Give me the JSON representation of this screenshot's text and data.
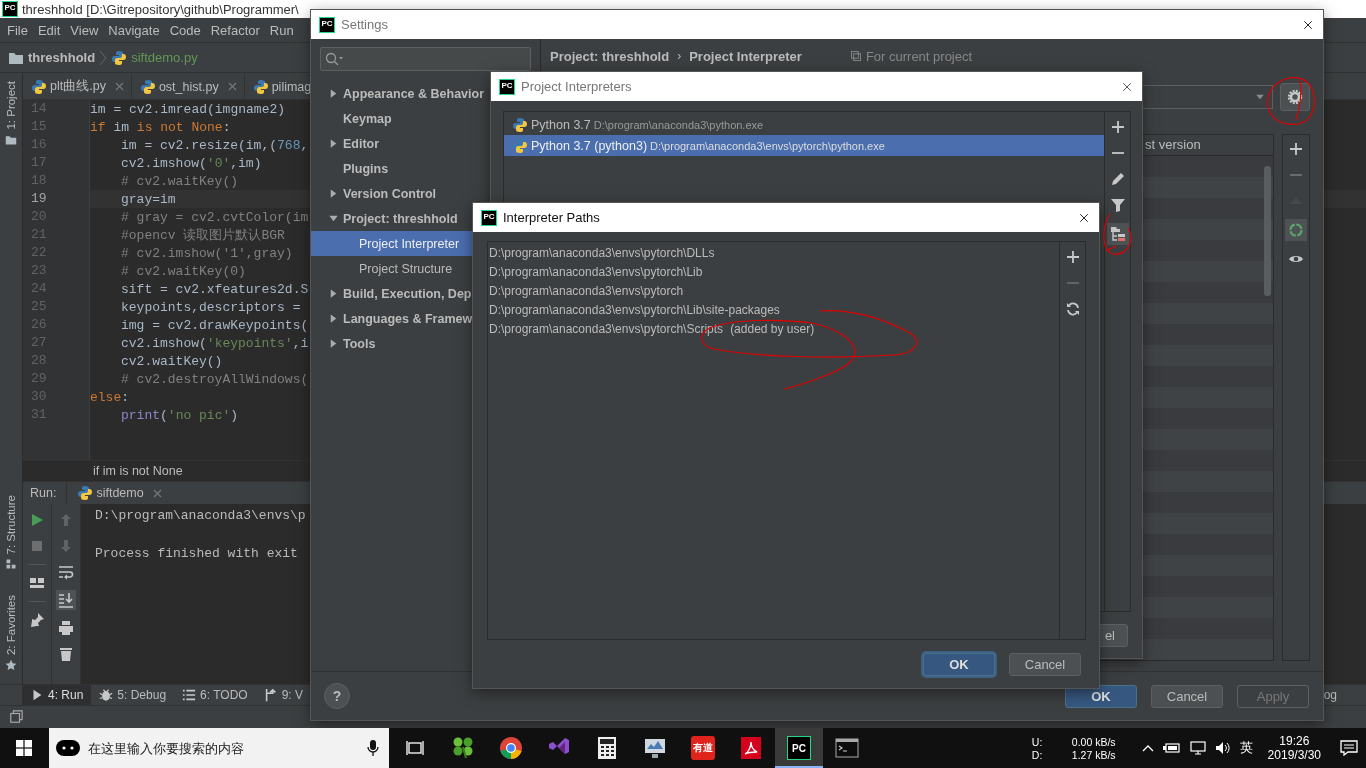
{
  "ide": {
    "logo": "PC",
    "title": "threshhold [D:\\Gitrepository\\github\\Programmer\\",
    "menu": [
      "File",
      "Edit",
      "View",
      "Navigate",
      "Code",
      "Refactor",
      "Run"
    ],
    "breadcrumb": {
      "project": "threshhold",
      "file": "siftdemo.py"
    },
    "side_tools": [
      {
        "label": "1: Project",
        "kind": "project"
      },
      {
        "label": "7: Structure",
        "kind": "structure"
      },
      {
        "label": "2: Favorites",
        "kind": "favorites"
      }
    ],
    "tabs": [
      {
        "label": "plt曲线.py",
        "closable": true
      },
      {
        "label": "ost_hist.py",
        "closable": true
      },
      {
        "label": "pilimag",
        "closable": false
      }
    ],
    "code_lines": [
      {
        "number": "14",
        "caret": false,
        "indented": false,
        "tokens": [
          {
            "kind": "plain",
            "text": "im = cv2.imread(imgname2)"
          }
        ]
      },
      {
        "number": "15",
        "caret": false,
        "indented": false,
        "tokens": [
          {
            "kind": "keyword",
            "text": "if"
          },
          {
            "kind": "plain",
            "text": " im "
          },
          {
            "kind": "keyword",
            "text": "is not None"
          },
          {
            "kind": "plain",
            "text": ":"
          }
        ]
      },
      {
        "number": "16",
        "caret": false,
        "indented": true,
        "tokens": [
          {
            "kind": "plain",
            "text": "im = cv2.resize(im,("
          },
          {
            "kind": "number",
            "text": "768"
          },
          {
            "kind": "plain",
            "text": ","
          }
        ]
      },
      {
        "number": "17",
        "caret": false,
        "indented": true,
        "tokens": [
          {
            "kind": "plain",
            "text": "cv2.imshow("
          },
          {
            "kind": "string",
            "text": "'0'"
          },
          {
            "kind": "plain",
            "text": ",im)"
          }
        ]
      },
      {
        "number": "18",
        "caret": false,
        "indented": true,
        "tokens": [
          {
            "kind": "comment",
            "text": "# cv2.waitKey()"
          }
        ]
      },
      {
        "number": "19",
        "caret": true,
        "indented": true,
        "tokens": [
          {
            "kind": "plain",
            "text": "gray=im"
          }
        ]
      },
      {
        "number": "20",
        "caret": false,
        "indented": true,
        "tokens": [
          {
            "kind": "comment",
            "text": "# gray = cv2.cvtColor(im"
          }
        ]
      },
      {
        "number": "21",
        "caret": false,
        "indented": true,
        "tokens": [
          {
            "kind": "comment",
            "text": "#opencv 读取图片默认BGR"
          }
        ]
      },
      {
        "number": "22",
        "caret": false,
        "indented": true,
        "tokens": [
          {
            "kind": "comment",
            "text": "# cv2.imshow('1',gray)"
          }
        ]
      },
      {
        "number": "23",
        "caret": false,
        "indented": true,
        "tokens": [
          {
            "kind": "comment",
            "text": "# cv2.waitKey(0)"
          }
        ]
      },
      {
        "number": "24",
        "caret": false,
        "indented": true,
        "tokens": [
          {
            "kind": "plain",
            "text": "sift = cv2.xfeatures2d.S"
          }
        ]
      },
      {
        "number": "25",
        "caret": false,
        "indented": true,
        "tokens": [
          {
            "kind": "plain",
            "text": "keypoints,descriptors ="
          }
        ]
      },
      {
        "number": "26",
        "caret": false,
        "indented": true,
        "tokens": [
          {
            "kind": "plain",
            "text": "img = cv2.drawKeypoints("
          }
        ]
      },
      {
        "number": "27",
        "caret": false,
        "indented": true,
        "tokens": [
          {
            "kind": "plain",
            "text": "cv2.imshow("
          },
          {
            "kind": "string",
            "text": "'keypoints'"
          },
          {
            "kind": "plain",
            "text": ",i"
          }
        ]
      },
      {
        "number": "28",
        "caret": false,
        "indented": true,
        "tokens": [
          {
            "kind": "plain",
            "text": "cv2.waitKey()"
          }
        ]
      },
      {
        "number": "29",
        "caret": false,
        "indented": true,
        "tokens": [
          {
            "kind": "comment",
            "text": "# cv2.destroyAllWindows("
          }
        ]
      },
      {
        "number": "30",
        "caret": false,
        "indented": false,
        "tokens": [
          {
            "kind": "keyword",
            "text": "else"
          },
          {
            "kind": "plain",
            "text": ":"
          }
        ]
      },
      {
        "number": "31",
        "caret": false,
        "indented": true,
        "tokens": [
          {
            "kind": "builtin",
            "text": "print"
          },
          {
            "kind": "plain",
            "text": "("
          },
          {
            "kind": "string",
            "text": "'no pic'"
          },
          {
            "kind": "plain",
            "text": ")"
          }
        ]
      }
    ],
    "code_crumb": "if im is not None",
    "run": {
      "label": "Run:",
      "tab": "siftdemo",
      "console": [
        "D:\\program\\anaconda3\\envs\\p",
        "Process finished with exit"
      ]
    },
    "tool_buttons": [
      {
        "label": "4: Run",
        "kind": "run",
        "selected": true
      },
      {
        "label": "5: Debug",
        "kind": "debug",
        "selected": false
      },
      {
        "label": "6: TODO",
        "kind": "todo",
        "selected": false
      },
      {
        "label": "9: V",
        "kind": "vcs",
        "selected": false
      }
    ],
    "event_log": "og"
  },
  "settings": {
    "logo": "PC",
    "title": "Settings",
    "tree": [
      {
        "label": "Appearance & Behavior",
        "expanded": false,
        "selected": false
      },
      {
        "label": "Keymap",
        "selected": false
      },
      {
        "label": "Editor",
        "expanded": false,
        "selected": false
      },
      {
        "label": "Plugins",
        "selected": false
      },
      {
        "label": "Version Control",
        "expanded": false,
        "selected": false
      },
      {
        "label": "Project: threshhold",
        "expanded": true,
        "selected": false,
        "children": [
          {
            "label": "Project Interpreter",
            "selected": true
          },
          {
            "label": "Project Structure",
            "selected": false
          }
        ]
      },
      {
        "label": "Build, Execution, Dep",
        "expanded": false,
        "selected": false
      },
      {
        "label": "Languages & Framew",
        "expanded": false,
        "selected": false
      },
      {
        "label": "Tools",
        "expanded": false,
        "selected": false
      }
    ],
    "header": {
      "project": "Project: threshhold",
      "separator": "›",
      "page": "Project Interpreter",
      "scope": "For current project"
    },
    "packages": {
      "column": "st version"
    },
    "package_tools": [
      {
        "kind": "add",
        "disabled": false
      },
      {
        "kind": "remove",
        "disabled": true
      },
      {
        "kind": "up",
        "disabled": true
      },
      {
        "kind": "refresh",
        "disabled": false
      },
      {
        "kind": "show",
        "disabled": false
      }
    ],
    "help": "?",
    "buttons": [
      {
        "label": "OK",
        "primary": true,
        "disabled": false
      },
      {
        "label": "Cancel",
        "primary": false,
        "disabled": false
      },
      {
        "label": "Apply",
        "primary": false,
        "disabled": true
      }
    ]
  },
  "interpreters": {
    "logo": "PC",
    "title": "Project Interpreters",
    "items": [
      {
        "name": "Python 3.7",
        "path": "D:\\program\\anaconda3\\python.exe",
        "selected": false
      },
      {
        "name": "Python 3.7 (python3)",
        "path": "D:\\program\\anaconda3\\envs\\pytorch\\python.exe",
        "selected": true
      }
    ],
    "tools": [
      {
        "kind": "add",
        "selected": false
      },
      {
        "kind": "remove",
        "selected": false
      },
      {
        "kind": "edit",
        "selected": false
      },
      {
        "kind": "filter",
        "selected": false
      },
      {
        "kind": "paths",
        "selected": true
      }
    ],
    "cancel_fragment": "el"
  },
  "paths": {
    "logo": "PC",
    "title": "Interpreter Paths",
    "items": [
      {
        "path": "D:\\program\\anaconda3\\envs\\pytorch\\DLLs"
      },
      {
        "path": "D:\\program\\anaconda3\\envs\\pytorch\\Lib"
      },
      {
        "path": "D:\\program\\anaconda3\\envs\\pytorch"
      },
      {
        "path": "D:\\program\\anaconda3\\envs\\pytorch\\Lib\\site-packages"
      },
      {
        "path": "D:\\program\\anaconda3\\envs\\pytorch\\Scripts",
        "note": "(added by user)"
      }
    ],
    "tools": [
      {
        "kind": "add",
        "disabled": false
      },
      {
        "kind": "remove",
        "disabled": true
      },
      {
        "kind": "refresh",
        "disabled": false
      }
    ],
    "buttons": [
      {
        "label": "OK",
        "primary": true
      },
      {
        "label": "Cancel",
        "primary": false
      }
    ]
  },
  "taskbar": {
    "search_placeholder": "在这里输入你要搜索的内容",
    "apps": [
      {
        "kind": "clover",
        "active": false
      },
      {
        "kind": "browser",
        "active": false
      },
      {
        "kind": "ribbon",
        "active": false
      },
      {
        "kind": "calculator",
        "active": false
      },
      {
        "kind": "monitor",
        "active": false
      },
      {
        "kind": "dictionary",
        "label": "有道",
        "active": false
      },
      {
        "kind": "pdf",
        "active": false
      },
      {
        "kind": "ide",
        "label": "PC",
        "active": true
      },
      {
        "kind": "terminal",
        "active": false
      }
    ],
    "net": [
      {
        "label": "U:",
        "value": "0.00 kB/s"
      },
      {
        "label": "D:",
        "value": "1.27 kB/s"
      }
    ],
    "ime": "英",
    "time": "19:26",
    "date": "2019/3/30"
  }
}
